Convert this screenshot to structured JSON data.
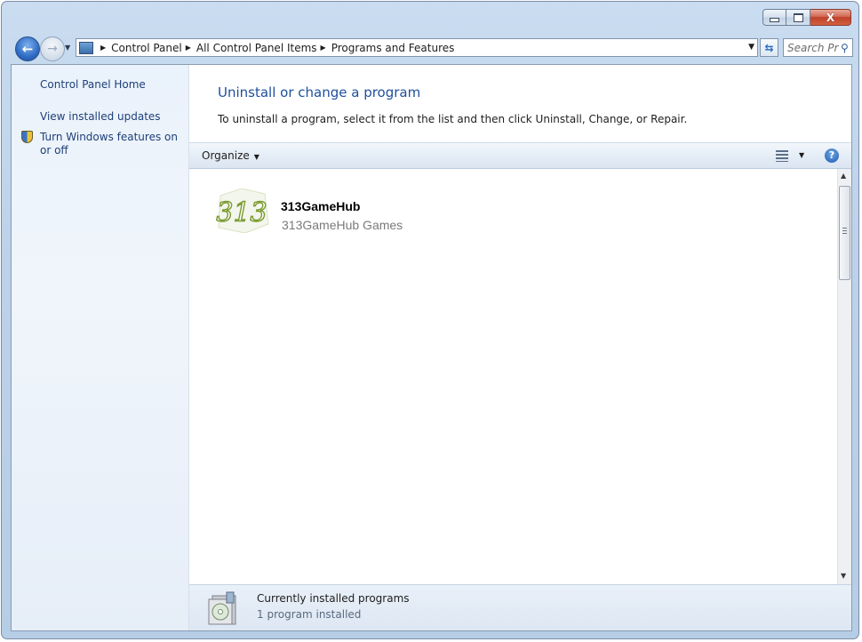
{
  "window": {
    "minimize_glyph": "—",
    "close_glyph": "X"
  },
  "navigation": {
    "breadcrumbs": [
      "Control Panel",
      "All Control Panel Items",
      "Programs and Features"
    ],
    "search_placeholder": "Search Pro..."
  },
  "sidebar": {
    "items": [
      {
        "label": "Control Panel Home"
      },
      {
        "label": "View installed updates"
      },
      {
        "label": "Turn Windows features on or off"
      }
    ]
  },
  "main": {
    "title": "Uninstall or change a program",
    "description": "To uninstall a program, select it from the list and then click Uninstall, Change, or Repair."
  },
  "toolbar": {
    "organize_label": "Organize",
    "help_glyph": "?"
  },
  "programs": [
    {
      "name": "313GameHub",
      "publisher": "313GameHub Games",
      "logo_text": "313"
    }
  ],
  "details": {
    "title": "Currently installed programs",
    "count": "1 program installed"
  },
  "colors": {
    "title_blue": "#1e4f9c",
    "link_blue": "#1e3f77",
    "logo_green": "#7a9a2e"
  },
  "icons": {
    "back": "back-arrow-icon",
    "forward": "forward-arrow-icon",
    "refresh": "refresh-icon",
    "search": "search-icon",
    "shield": "shield-icon",
    "views": "views-icon",
    "help": "help-icon",
    "installed_programs": "installed-programs-icon"
  }
}
